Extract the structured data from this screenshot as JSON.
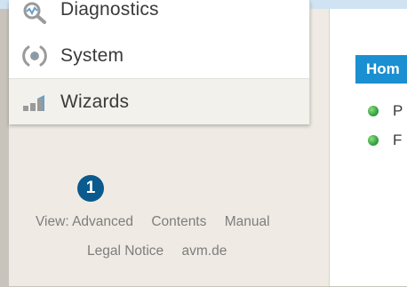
{
  "menu": {
    "items": [
      {
        "label": "Diagnostics",
        "icon": "diagnostics-icon"
      },
      {
        "label": "System",
        "icon": "system-icon"
      },
      {
        "label": "Wizards",
        "icon": "wizards-icon"
      }
    ]
  },
  "notification_badge": {
    "count": "1"
  },
  "footer": {
    "view_label": "View: Advanced",
    "contents_label": "Contents",
    "manual_label": "Manual",
    "legal_label": "Legal Notice",
    "site_label": "avm.de"
  },
  "main": {
    "home_tab_label": "Hom",
    "status_items": [
      {
        "label": "P",
        "status_color": "#3aa64a"
      },
      {
        "label": "F",
        "status_color": "#3aa64a"
      }
    ]
  },
  "colors": {
    "accent": "#1a8fd1",
    "badge": "#0a5a8e",
    "icon_gray": "#9a9a9a",
    "icon_blue": "#6aa0c8"
  }
}
